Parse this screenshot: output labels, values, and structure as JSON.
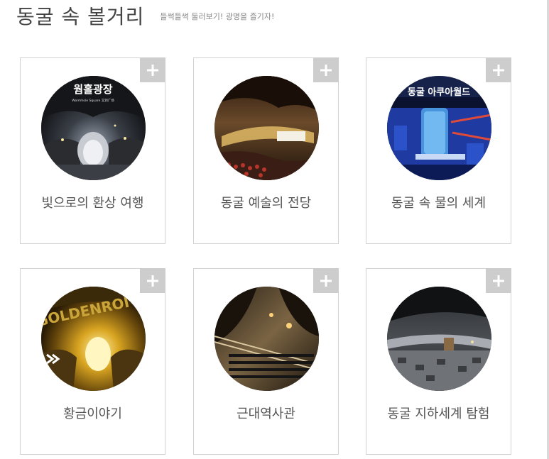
{
  "header": {
    "title": "동굴 속 볼거리",
    "subtitle": "들썩들썩 둘러보기! 광명을 즐기자!"
  },
  "cards": [
    {
      "label": "빛으로의 환상 여행",
      "image_sign": "웜홀광장",
      "image_sign_small": "Wormhole Square 又洞广场",
      "icon": "plus-icon"
    },
    {
      "label": "동굴 예술의 전당",
      "icon": "plus-icon"
    },
    {
      "label": "동굴 속 물의 세계",
      "image_sign": "동굴 아쿠아월드",
      "icon": "plus-icon"
    },
    {
      "label": "황금이야기",
      "image_sign": "GOLDENROI",
      "icon": "plus-icon"
    },
    {
      "label": "근대역사관",
      "icon": "plus-icon"
    },
    {
      "label": "동굴 지하세계 탐험",
      "icon": "plus-icon"
    }
  ],
  "colors": {
    "card_border": "#d2d2d2",
    "plus_bg": "#cdcdcd",
    "plus_fg": "#ffffff",
    "title": "#444444",
    "label": "#555555"
  }
}
